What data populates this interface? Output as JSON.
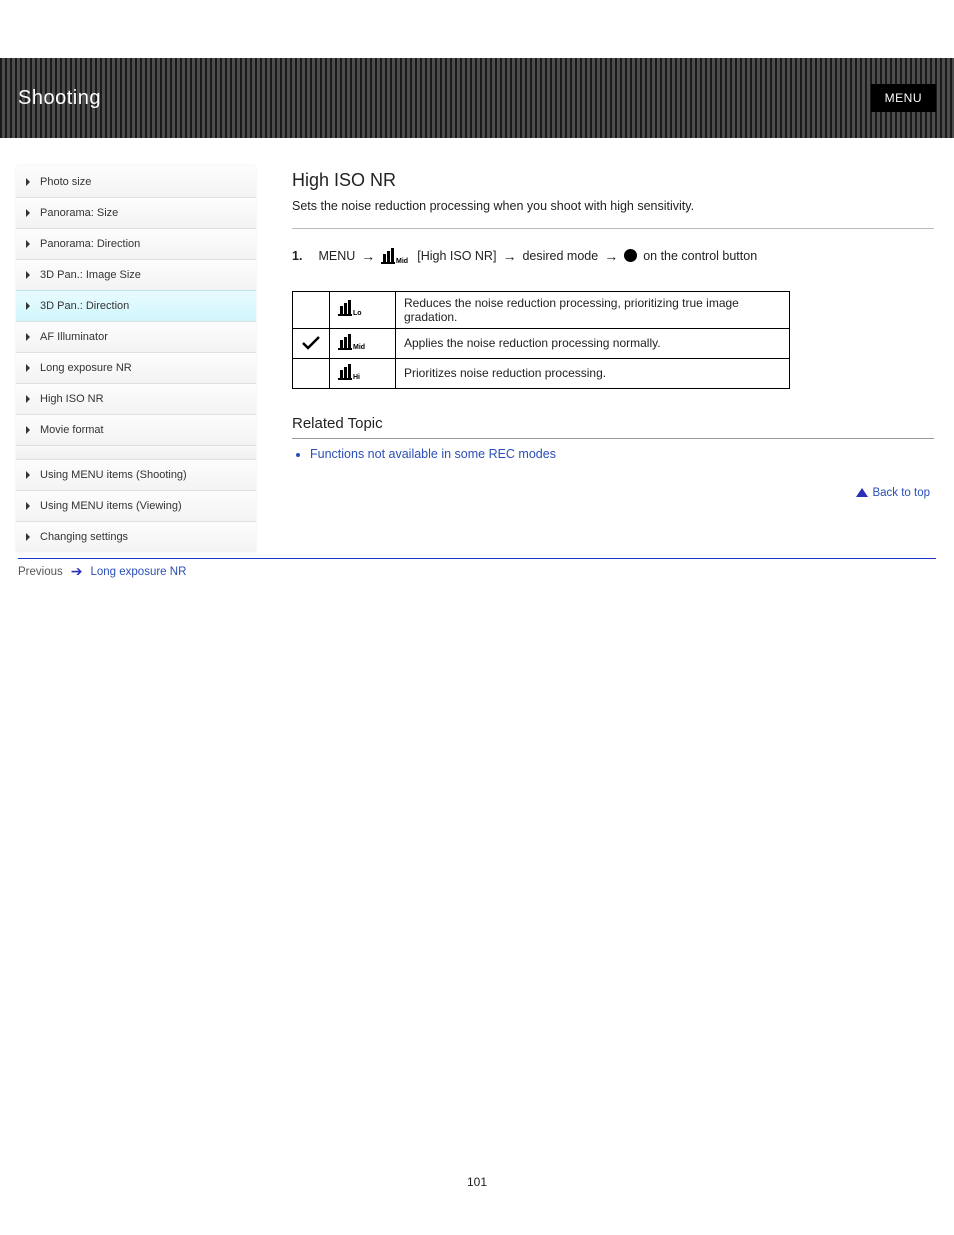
{
  "header": {
    "title": "Shooting",
    "badge": "MENU"
  },
  "sidebar": {
    "items": [
      {
        "label": "Photo size"
      },
      {
        "label": "Panorama: Size"
      },
      {
        "label": "Panorama: Direction"
      },
      {
        "label": "3D Pan.: Image Size"
      },
      {
        "label": "3D Pan.: Direction",
        "active": true
      },
      {
        "label": "AF Illuminator"
      },
      {
        "label": "Long exposure NR"
      },
      {
        "label": "High ISO NR"
      },
      {
        "label": "Movie format"
      }
    ],
    "secondary": [
      {
        "label": "Using MENU items (Shooting)"
      },
      {
        "label": "Using MENU items (Viewing)"
      },
      {
        "label": "Changing settings"
      }
    ]
  },
  "main": {
    "title": "High ISO NR",
    "intro": "Sets the noise reduction processing when you shoot with high sensitivity.",
    "path": {
      "step1": "MENU",
      "step2": "[High ISO NR]",
      "step3": "desired mode",
      "step4_suffix": "on the control button"
    },
    "rows": [
      {
        "checked": false,
        "variant": "Lo",
        "desc": "Reduces the noise reduction processing, prioritizing true image gradation."
      },
      {
        "checked": true,
        "variant": "Mid",
        "desc": "Applies the noise reduction processing normally."
      },
      {
        "checked": false,
        "variant": "Hi",
        "desc": "Prioritizes noise reduction processing."
      }
    ],
    "related": {
      "heading": "Related Topic",
      "links": [
        "Functions not available in some REC modes"
      ]
    },
    "back_top": "Back to top"
  },
  "footer": {
    "prev_label": "Previous",
    "prev_link": "Long exposure NR"
  },
  "page_number": "101"
}
